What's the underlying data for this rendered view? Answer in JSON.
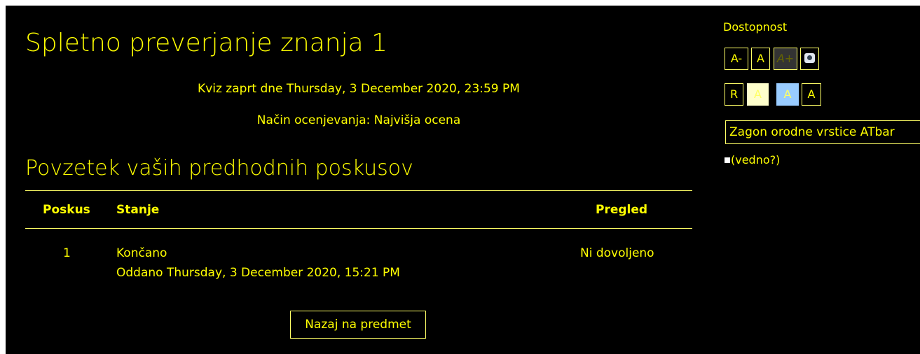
{
  "main": {
    "title": "Spletno preverjanje znanja 1",
    "closed_info": "Kviz zaprt dne Thursday, 3 December 2020, 23:59 PM",
    "grading_method": "Način ocenjevanja: Najvišja ocena",
    "summary_title": "Povzetek vaših predhodnih poskusov"
  },
  "table": {
    "headers": [
      "Poskus",
      "Stanje",
      "Pregled"
    ],
    "rows": [
      {
        "attempt": "1",
        "state": "Končano",
        "submitted": "Oddano Thursday, 3 December 2020, 15:21 PM",
        "review": "Ni dovoljeno"
      }
    ]
  },
  "back_button_label": "Nazaj na predmet",
  "accessibility": {
    "title": "Dostopnost",
    "font_buttons": [
      "A-",
      "A",
      "A+"
    ],
    "read_icon": "speaker-icon",
    "contrast_buttons": [
      "R",
      "A",
      "A",
      "A"
    ],
    "contrast_colors": [
      "#000000",
      "#ffffcc",
      "#99ccff",
      "#000000"
    ],
    "atbar_button_label": "Zagon orodne vrstice ATbar",
    "always_label": "(vedno?)"
  },
  "colors": {
    "background": "#000000",
    "text": "#ffff00"
  }
}
